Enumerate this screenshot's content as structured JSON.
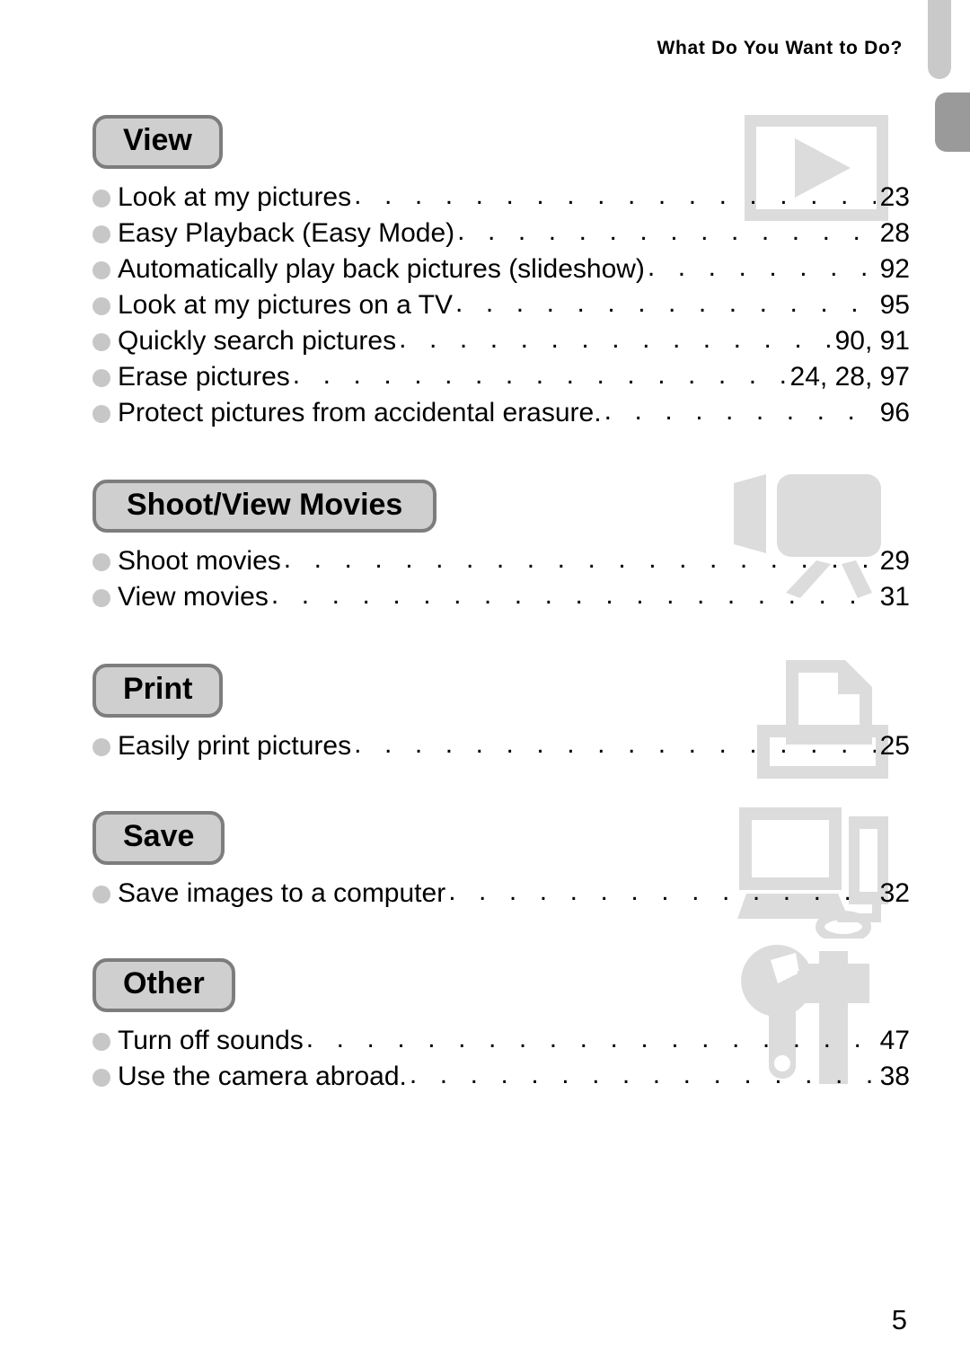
{
  "header": {
    "title": "What Do You Want to Do?"
  },
  "folio": {
    "page_number": "5"
  },
  "colors": {
    "pill_fill": "#cfcfcf",
    "pill_border": "#7d7d7d",
    "bullet": "#c7c7c7",
    "icon_gray": "#dcdcdc",
    "tab_light": "#c9c9c9",
    "tab_dark": "#9a9a9a"
  },
  "tabs": [
    {
      "name": "tab-marker-light",
      "shade": "light"
    },
    {
      "name": "tab-marker-dark",
      "shade": "dark"
    }
  ],
  "sections": [
    {
      "id": "view",
      "heading": "View",
      "icon": "play-screen-icon",
      "entries": [
        {
          "label": "Look at my pictures",
          "page": "23"
        },
        {
          "label": "Easy Playback (Easy Mode)",
          "page": "28"
        },
        {
          "label": "Automatically play back pictures (slideshow)",
          "page": "92"
        },
        {
          "label": "Look at my pictures on a TV",
          "page": "95"
        },
        {
          "label": "Quickly search pictures",
          "page": "90, 91"
        },
        {
          "label": "Erase pictures",
          "page": "24, 28, 97"
        },
        {
          "label": "Protect pictures from accidental erasure.",
          "page": "96"
        }
      ]
    },
    {
      "id": "shoot-view-movies",
      "heading": "Shoot/View Movies",
      "icon": "camcorder-icon",
      "entries": [
        {
          "label": "Shoot movies",
          "page": "29"
        },
        {
          "label": "View movies",
          "page": "31"
        }
      ]
    },
    {
      "id": "print",
      "heading": "Print",
      "icon": "printer-icon",
      "entries": [
        {
          "label": "Easily print pictures",
          "page": "25"
        }
      ]
    },
    {
      "id": "save",
      "heading": "Save",
      "icon": "computer-icon",
      "entries": [
        {
          "label": "Save images to a computer",
          "page": "32"
        }
      ]
    },
    {
      "id": "other",
      "heading": "Other",
      "icon": "tools-icon",
      "entries": [
        {
          "label": "Turn off sounds",
          "page": "47"
        },
        {
          "label": "Use the camera abroad.",
          "page": "38"
        }
      ]
    }
  ],
  "leader_dots": ". . . . . . . . . . . . . . . . . . . . . . . . . . . . . . . . . . . . . . . . . . . . . . . . . . . . . . . . . . . . . ."
}
